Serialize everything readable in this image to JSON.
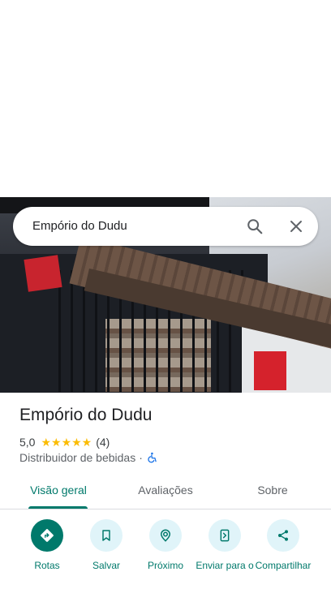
{
  "search": {
    "query": "Empório do Dudu"
  },
  "place": {
    "name": "Empório do Dudu",
    "rating": "5,0",
    "stars": "★★★★★",
    "review_count": "(4)",
    "category": "Distribuidor de bebidas",
    "separator": "·"
  },
  "tabs": [
    {
      "label": "Visão geral",
      "active": true
    },
    {
      "label": "Avaliações",
      "active": false
    },
    {
      "label": "Sobre",
      "active": false
    }
  ],
  "actions": [
    {
      "label": "Rotas",
      "icon": "directions-icon"
    },
    {
      "label": "Salvar",
      "icon": "bookmark-icon"
    },
    {
      "label": "Próximo",
      "icon": "nearby-icon"
    },
    {
      "label": "Enviar para o",
      "icon": "send-to-phone-icon"
    },
    {
      "label": "Compartilhar",
      "icon": "share-icon"
    }
  ],
  "colors": {
    "accent": "#00796b",
    "action_bg": "#e0f4f9",
    "star": "#fbbc04",
    "accessibility": "#1a73e8"
  }
}
